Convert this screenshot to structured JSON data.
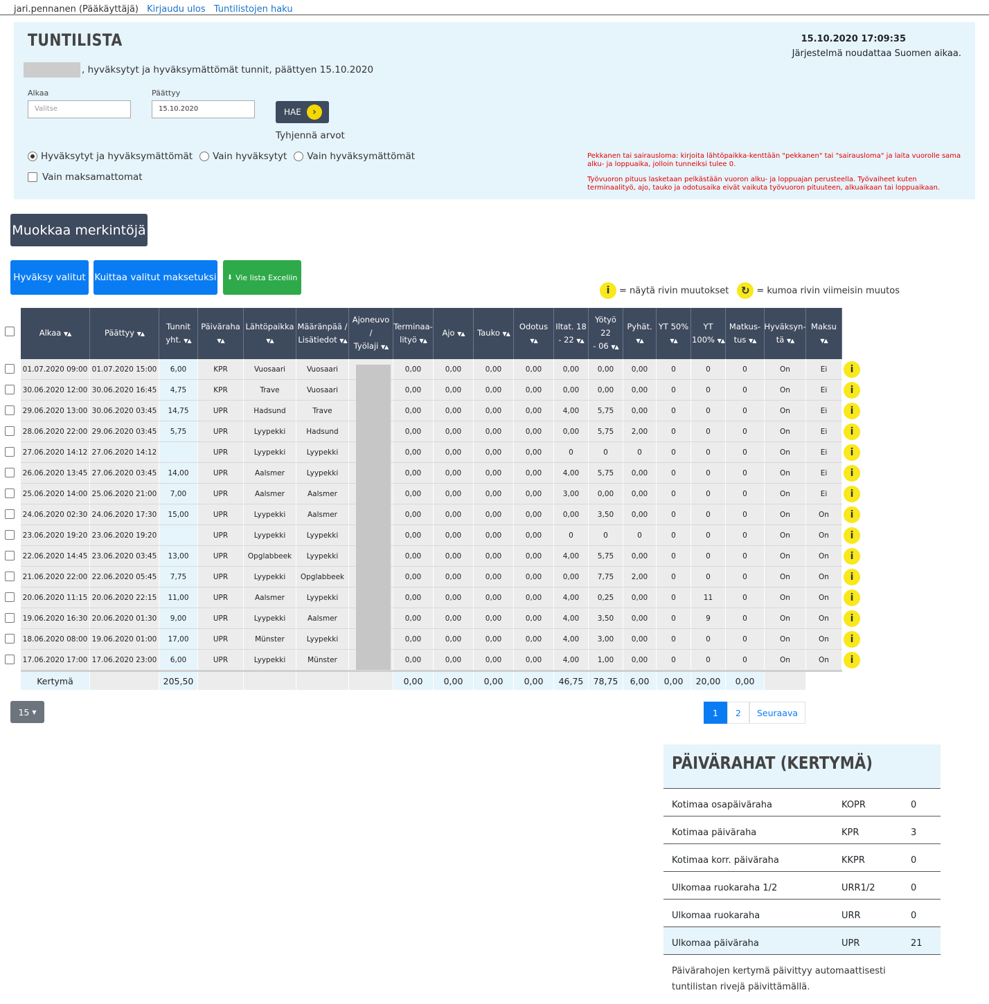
{
  "nav": {
    "user": "jari.pennanen (Pääkäyttäjä)",
    "logout": "Kirjaudu ulos",
    "search": "Tuntilistojen haku"
  },
  "header": {
    "title": "TUNTILISTA",
    "datetime": "15.10.2020 17:09:35",
    "timezone": "Järjestelmä noudattaa Suomen aikaa.",
    "subtitle": ", hyväksytyt ja hyväksymättömät tunnit, päättyen 15.10.2020"
  },
  "filters": {
    "start_label": "Alkaa",
    "start_placeholder": "Valitse",
    "end_label": "Päättyy",
    "end_value": "15.10.2020",
    "search_button": "HAE",
    "clear": "Tyhjennä arvot",
    "radio_all": "Hyväksytyt ja hyväksymättömät",
    "radio_approved": "Vain hyväksytyt",
    "radio_unapproved": "Vain hyväksymättömät",
    "unpaid": "Vain maksamattomat",
    "selected_radio": "all"
  },
  "notes": {
    "leave": "Pekkanen tai sairausloma: kirjoita lähtöpaikka-kenttään \"pekkanen\" tai \"sairausloma\" ja laita vuorolle sama alku- ja loppuaika, jolloin tunneiksi tulee 0.",
    "shift": "Työvuoron pituus lasketaan pelkästään vuoron alku- ja loppuajan perusteella. Työvaiheet kuten terminaalityö, ajo, tauko ja odotusaika eivät vaikuta työvuoron pituuteen, alkuaikaan tai loppuaikaan."
  },
  "actions": {
    "edit": "Muokkaa merkintöjä",
    "approve": "Hyväksy valitut",
    "mark_paid": "Kuittaa valitut maksetuksi",
    "export": "Vie lista Exceliin"
  },
  "legend": {
    "info": "= näytä rivin muutokset",
    "undo": "= kumoa rivin viimeisin muutos"
  },
  "table": {
    "columns": [
      {
        "l1": "Alkaa",
        "l2": ""
      },
      {
        "l1": "Päättyy",
        "l2": ""
      },
      {
        "l1": "Tunnit",
        "l2": "yht."
      },
      {
        "l1": "Päiväraha",
        "l2": ""
      },
      {
        "l1": "Lähtöpaikka",
        "l2": ""
      },
      {
        "l1": "Määränpää /",
        "l2": "Lisätiedot"
      },
      {
        "l1": "Ajoneuvo /",
        "l2": "Työlaji"
      },
      {
        "l1": "Terminaa-",
        "l2": "lityö"
      },
      {
        "l1": "Ajo",
        "l2": ""
      },
      {
        "l1": "Tauko",
        "l2": ""
      },
      {
        "l1": "Odotus",
        "l2": ""
      },
      {
        "l1": "Iltat. 18",
        "l2": "- 22"
      },
      {
        "l1": "Yötyö 22",
        "l2": "- 06"
      },
      {
        "l1": "Pyhät.",
        "l2": ""
      },
      {
        "l1": "YT 50%",
        "l2": ""
      },
      {
        "l1": "YT 100%",
        "l2": ""
      },
      {
        "l1": "Matkus-",
        "l2": "tus"
      },
      {
        "l1": "Hyväksyn-",
        "l2": "tä"
      },
      {
        "l1": "Maksu",
        "l2": ""
      }
    ],
    "rows": [
      [
        "01.07.2020 09:00",
        "01.07.2020 15:00",
        "6,00",
        "KPR",
        "Vuosaari",
        "Vuosaari",
        "",
        "0,00",
        "0,00",
        "0,00",
        "0,00",
        "0,00",
        "0,00",
        "0,00",
        "0",
        "0",
        "0",
        "On",
        "Ei"
      ],
      [
        "30.06.2020 12:00",
        "30.06.2020 16:45",
        "4,75",
        "KPR",
        "Trave",
        "Vuosaari",
        "",
        "0,00",
        "0,00",
        "0,00",
        "0,00",
        "0,00",
        "0,00",
        "0,00",
        "0",
        "0",
        "0",
        "On",
        "Ei"
      ],
      [
        "29.06.2020 13:00",
        "30.06.2020 03:45",
        "14,75",
        "UPR",
        "Hadsund",
        "Trave",
        "",
        "0,00",
        "0,00",
        "0,00",
        "0,00",
        "4,00",
        "5,75",
        "0,00",
        "0",
        "0",
        "0",
        "On",
        "Ei"
      ],
      [
        "28.06.2020 22:00",
        "29.06.2020 03:45",
        "5,75",
        "UPR",
        "Lyypekki",
        "Hadsund",
        "",
        "0,00",
        "0,00",
        "0,00",
        "0,00",
        "0,00",
        "5,75",
        "2,00",
        "0",
        "0",
        "0",
        "On",
        "Ei"
      ],
      [
        "27.06.2020 14:12",
        "27.06.2020 14:12",
        "",
        "UPR",
        "Lyypekki",
        "Lyypekki",
        "",
        "0,00",
        "0,00",
        "0,00",
        "0,00",
        "0",
        "0",
        "0",
        "0",
        "0",
        "0",
        "On",
        "Ei"
      ],
      [
        "26.06.2020 13:45",
        "27.06.2020 03:45",
        "14,00",
        "UPR",
        "Aalsmer",
        "Lyypekki",
        "",
        "0,00",
        "0,00",
        "0,00",
        "0,00",
        "4,00",
        "5,75",
        "0,00",
        "0",
        "0",
        "0",
        "On",
        "Ei"
      ],
      [
        "25.06.2020 14:00",
        "25.06.2020 21:00",
        "7,00",
        "UPR",
        "Aalsmer",
        "Aalsmer",
        "",
        "0,00",
        "0,00",
        "0,00",
        "0,00",
        "3,00",
        "0,00",
        "0,00",
        "0",
        "0",
        "0",
        "On",
        "Ei"
      ],
      [
        "24.06.2020 02:30",
        "24.06.2020 17:30",
        "15,00",
        "UPR",
        "Lyypekki",
        "Aalsmer",
        "",
        "0,00",
        "0,00",
        "0,00",
        "0,00",
        "0,00",
        "3,50",
        "0,00",
        "0",
        "0",
        "0",
        "On",
        "On"
      ],
      [
        "23.06.2020 19:20",
        "23.06.2020 19:20",
        "",
        "UPR",
        "Lyypekki",
        "Lyypekki",
        "",
        "0,00",
        "0,00",
        "0,00",
        "0,00",
        "0",
        "0",
        "0",
        "0",
        "0",
        "0",
        "On",
        "On"
      ],
      [
        "22.06.2020 14:45",
        "23.06.2020 03:45",
        "13,00",
        "UPR",
        "Opglabbeek",
        "Lyypekki",
        "",
        "0,00",
        "0,00",
        "0,00",
        "0,00",
        "4,00",
        "5,75",
        "0,00",
        "0",
        "0",
        "0",
        "On",
        "On"
      ],
      [
        "21.06.2020 22:00",
        "22.06.2020 05:45",
        "7,75",
        "UPR",
        "Lyypekki",
        "Opglabbeek",
        "",
        "0,00",
        "0,00",
        "0,00",
        "0,00",
        "0,00",
        "7,75",
        "2,00",
        "0",
        "0",
        "0",
        "On",
        "On"
      ],
      [
        "20.06.2020 11:15",
        "20.06.2020 22:15",
        "11,00",
        "UPR",
        "Aalsmer",
        "Lyypekki",
        "",
        "0,00",
        "0,00",
        "0,00",
        "0,00",
        "4,00",
        "0,25",
        "0,00",
        "0",
        "11",
        "0",
        "On",
        "On"
      ],
      [
        "19.06.2020 16:30",
        "20.06.2020 01:30",
        "9,00",
        "UPR",
        "Lyypekki",
        "Aalsmer",
        "",
        "0,00",
        "0,00",
        "0,00",
        "0,00",
        "4,00",
        "3,50",
        "0,00",
        "0",
        "9",
        "0",
        "On",
        "On"
      ],
      [
        "18.06.2020 08:00",
        "19.06.2020 01:00",
        "17,00",
        "UPR",
        "Münster",
        "Lyypekki",
        "",
        "0,00",
        "0,00",
        "0,00",
        "0,00",
        "4,00",
        "3,00",
        "0,00",
        "0",
        "0",
        "0",
        "On",
        "On"
      ],
      [
        "17.06.2020 17:00",
        "17.06.2020 23:00",
        "6,00",
        "UPR",
        "Lyypekki",
        "Münster",
        "",
        "0,00",
        "0,00",
        "0,00",
        "0,00",
        "4,00",
        "1,00",
        "0,00",
        "0",
        "0",
        "0",
        "On",
        "On"
      ]
    ],
    "footer": [
      "Kertymä",
      "",
      "205,50",
      "",
      "",
      "",
      "",
      "0,00",
      "0,00",
      "0,00",
      "0,00",
      "46,75",
      "78,75",
      "6,00",
      "0,00",
      "20,00",
      "0,00",
      ""
    ]
  },
  "pagination": {
    "page_size": "15",
    "pages": [
      "1",
      "2"
    ],
    "next": "Seuraava",
    "current": "1"
  },
  "perdiem": {
    "title": "PÄIVÄRAHAT (KERTYMÄ)",
    "rows": [
      {
        "name": "Kotimaa osapäiväraha",
        "code": "KOPR",
        "value": "0"
      },
      {
        "name": "Kotimaa päiväraha",
        "code": "KPR",
        "value": "3"
      },
      {
        "name": "Kotimaa korr. päiväraha",
        "code": "KKPR",
        "value": "0"
      },
      {
        "name": "Ulkomaa ruokaraha 1/2",
        "code": "URR1/2",
        "value": "0"
      },
      {
        "name": "Ulkomaa ruokaraha",
        "code": "URR",
        "value": "0"
      },
      {
        "name": "Ulkomaa päiväraha",
        "code": "UPR",
        "value": "21"
      }
    ],
    "note": "Päivärahojen kertymä päivittyy automaattisesti tuntilistan rivejä päivittämällä."
  },
  "colors": {
    "dark": "#3e4a5e",
    "primary": "#0a7cf3",
    "success": "#2eaa4a",
    "panel": "#e6f4fb",
    "info_icon": "#f8e81c",
    "note_red": "#e00000"
  }
}
